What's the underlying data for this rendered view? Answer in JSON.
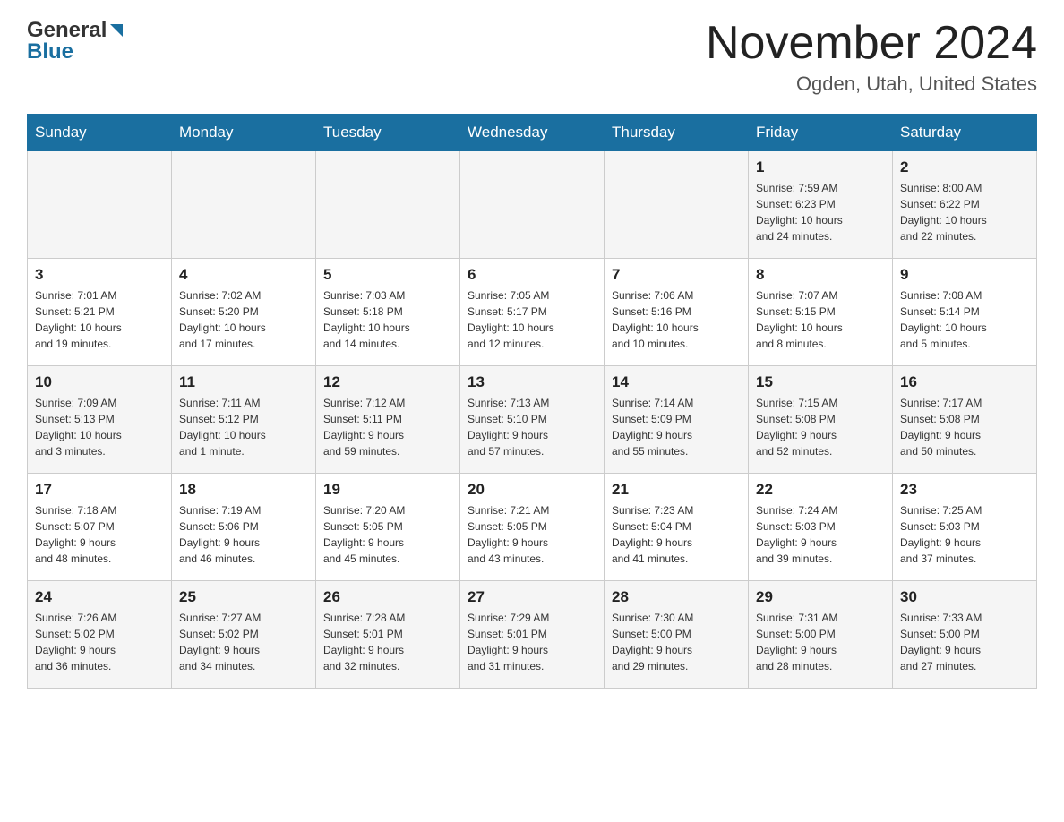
{
  "logo": {
    "general": "General",
    "blue": "Blue"
  },
  "header": {
    "title": "November 2024",
    "subtitle": "Ogden, Utah, United States"
  },
  "days_of_week": [
    "Sunday",
    "Monday",
    "Tuesday",
    "Wednesday",
    "Thursday",
    "Friday",
    "Saturday"
  ],
  "weeks": [
    [
      {
        "day": "",
        "info": ""
      },
      {
        "day": "",
        "info": ""
      },
      {
        "day": "",
        "info": ""
      },
      {
        "day": "",
        "info": ""
      },
      {
        "day": "",
        "info": ""
      },
      {
        "day": "1",
        "info": "Sunrise: 7:59 AM\nSunset: 6:23 PM\nDaylight: 10 hours\nand 24 minutes."
      },
      {
        "day": "2",
        "info": "Sunrise: 8:00 AM\nSunset: 6:22 PM\nDaylight: 10 hours\nand 22 minutes."
      }
    ],
    [
      {
        "day": "3",
        "info": "Sunrise: 7:01 AM\nSunset: 5:21 PM\nDaylight: 10 hours\nand 19 minutes."
      },
      {
        "day": "4",
        "info": "Sunrise: 7:02 AM\nSunset: 5:20 PM\nDaylight: 10 hours\nand 17 minutes."
      },
      {
        "day": "5",
        "info": "Sunrise: 7:03 AM\nSunset: 5:18 PM\nDaylight: 10 hours\nand 14 minutes."
      },
      {
        "day": "6",
        "info": "Sunrise: 7:05 AM\nSunset: 5:17 PM\nDaylight: 10 hours\nand 12 minutes."
      },
      {
        "day": "7",
        "info": "Sunrise: 7:06 AM\nSunset: 5:16 PM\nDaylight: 10 hours\nand 10 minutes."
      },
      {
        "day": "8",
        "info": "Sunrise: 7:07 AM\nSunset: 5:15 PM\nDaylight: 10 hours\nand 8 minutes."
      },
      {
        "day": "9",
        "info": "Sunrise: 7:08 AM\nSunset: 5:14 PM\nDaylight: 10 hours\nand 5 minutes."
      }
    ],
    [
      {
        "day": "10",
        "info": "Sunrise: 7:09 AM\nSunset: 5:13 PM\nDaylight: 10 hours\nand 3 minutes."
      },
      {
        "day": "11",
        "info": "Sunrise: 7:11 AM\nSunset: 5:12 PM\nDaylight: 10 hours\nand 1 minute."
      },
      {
        "day": "12",
        "info": "Sunrise: 7:12 AM\nSunset: 5:11 PM\nDaylight: 9 hours\nand 59 minutes."
      },
      {
        "day": "13",
        "info": "Sunrise: 7:13 AM\nSunset: 5:10 PM\nDaylight: 9 hours\nand 57 minutes."
      },
      {
        "day": "14",
        "info": "Sunrise: 7:14 AM\nSunset: 5:09 PM\nDaylight: 9 hours\nand 55 minutes."
      },
      {
        "day": "15",
        "info": "Sunrise: 7:15 AM\nSunset: 5:08 PM\nDaylight: 9 hours\nand 52 minutes."
      },
      {
        "day": "16",
        "info": "Sunrise: 7:17 AM\nSunset: 5:08 PM\nDaylight: 9 hours\nand 50 minutes."
      }
    ],
    [
      {
        "day": "17",
        "info": "Sunrise: 7:18 AM\nSunset: 5:07 PM\nDaylight: 9 hours\nand 48 minutes."
      },
      {
        "day": "18",
        "info": "Sunrise: 7:19 AM\nSunset: 5:06 PM\nDaylight: 9 hours\nand 46 minutes."
      },
      {
        "day": "19",
        "info": "Sunrise: 7:20 AM\nSunset: 5:05 PM\nDaylight: 9 hours\nand 45 minutes."
      },
      {
        "day": "20",
        "info": "Sunrise: 7:21 AM\nSunset: 5:05 PM\nDaylight: 9 hours\nand 43 minutes."
      },
      {
        "day": "21",
        "info": "Sunrise: 7:23 AM\nSunset: 5:04 PM\nDaylight: 9 hours\nand 41 minutes."
      },
      {
        "day": "22",
        "info": "Sunrise: 7:24 AM\nSunset: 5:03 PM\nDaylight: 9 hours\nand 39 minutes."
      },
      {
        "day": "23",
        "info": "Sunrise: 7:25 AM\nSunset: 5:03 PM\nDaylight: 9 hours\nand 37 minutes."
      }
    ],
    [
      {
        "day": "24",
        "info": "Sunrise: 7:26 AM\nSunset: 5:02 PM\nDaylight: 9 hours\nand 36 minutes."
      },
      {
        "day": "25",
        "info": "Sunrise: 7:27 AM\nSunset: 5:02 PM\nDaylight: 9 hours\nand 34 minutes."
      },
      {
        "day": "26",
        "info": "Sunrise: 7:28 AM\nSunset: 5:01 PM\nDaylight: 9 hours\nand 32 minutes."
      },
      {
        "day": "27",
        "info": "Sunrise: 7:29 AM\nSunset: 5:01 PM\nDaylight: 9 hours\nand 31 minutes."
      },
      {
        "day": "28",
        "info": "Sunrise: 7:30 AM\nSunset: 5:00 PM\nDaylight: 9 hours\nand 29 minutes."
      },
      {
        "day": "29",
        "info": "Sunrise: 7:31 AM\nSunset: 5:00 PM\nDaylight: 9 hours\nand 28 minutes."
      },
      {
        "day": "30",
        "info": "Sunrise: 7:33 AM\nSunset: 5:00 PM\nDaylight: 9 hours\nand 27 minutes."
      }
    ]
  ]
}
